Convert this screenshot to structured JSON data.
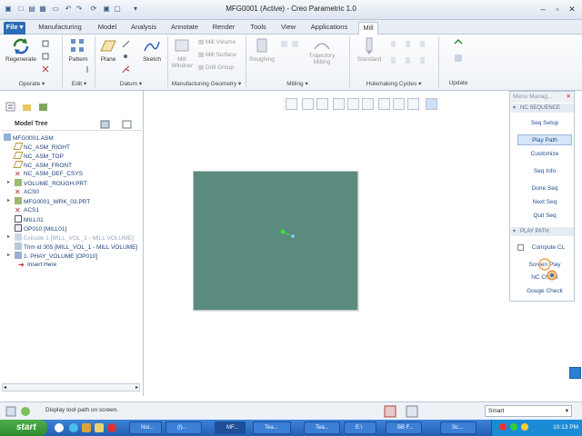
{
  "window": {
    "title": "MFG0001 (Active) - Creo Parametric 1.0"
  },
  "tabs": [
    {
      "label": "File"
    },
    {
      "label": "Manufacturing"
    },
    {
      "label": "Model"
    },
    {
      "label": "Analysis"
    },
    {
      "label": "Annotate"
    },
    {
      "label": "Render"
    },
    {
      "label": "Tools"
    },
    {
      "label": "View"
    },
    {
      "label": "Applications"
    },
    {
      "label": "Mill"
    }
  ],
  "ribbon": {
    "buttons": {
      "regenerate": "Regenerate",
      "pattern": "Pattern",
      "plane": "Plane",
      "sketch": "Sketch",
      "mill_window": "Mill Window",
      "mill_volume": "Mill Volume",
      "mill_surface": "Mill Surface",
      "drill_group": "Drill Group",
      "roughing": "Roughing",
      "trajectory_milling": "Trajectory Milling",
      "standard": "Standard"
    },
    "groups": {
      "operate": "Operate",
      "edit": "Edit",
      "datum": "Datum",
      "mfg_geometry": "Manufacturing Geometry",
      "milling": "Milling",
      "holemaking": "Holemaking Cycles",
      "update": "Update"
    }
  },
  "model_tree": {
    "title": "Model Tree",
    "items": [
      {
        "label": "MFG0001.ASM"
      },
      {
        "label": "NC_ASM_RIGHT"
      },
      {
        "label": "NC_ASM_TOP"
      },
      {
        "label": "NC_ASM_FRONT"
      },
      {
        "label": "NC_ASM_DEF_CSYS"
      },
      {
        "label": "VOLUME_ROUGH.PRT"
      },
      {
        "label": "ACS0"
      },
      {
        "label": "MFG0001_WRK_03.PRT"
      },
      {
        "label": "ACS1"
      },
      {
        "label": "MILL01"
      },
      {
        "label": "OP010 [MILL01]"
      },
      {
        "label": "Extrude 1 [MILL_VOL_1 - MILL VOLUME]"
      },
      {
        "label": "Trim id 305 [MILL_VOL_1 - MILL VOLUME]"
      },
      {
        "label": "1. PHAY_VOLUME [OP010]"
      },
      {
        "label": "Insert Here"
      }
    ]
  },
  "menu_manager": {
    "title": "Menu Manag...",
    "sections": {
      "nc_sequence": "NC SEQUENCE",
      "play_path": "PLAY PATH"
    },
    "nc_items": [
      "Seq Setup",
      "Play Path",
      "Customize",
      "Seq Info",
      "Done Seq",
      "Next Seq",
      "Quit Seq"
    ],
    "play_items": [
      "Compute CL",
      "Screen Play",
      "NC Check",
      "Gouge Check"
    ]
  },
  "status": {
    "message": "Display tool path on screen.",
    "filter_value": "Smart"
  },
  "taskbar": {
    "start": "start",
    "tasks": [
      "Noi...",
      "(I)...",
      "MF...",
      "Tea...",
      "Tea...",
      "E:\\",
      "BB F...",
      "Sc..."
    ],
    "clock": "10:13 PM"
  },
  "colors": {
    "part_fill": "#5b8b7e",
    "accent": "#2d6bb5"
  }
}
